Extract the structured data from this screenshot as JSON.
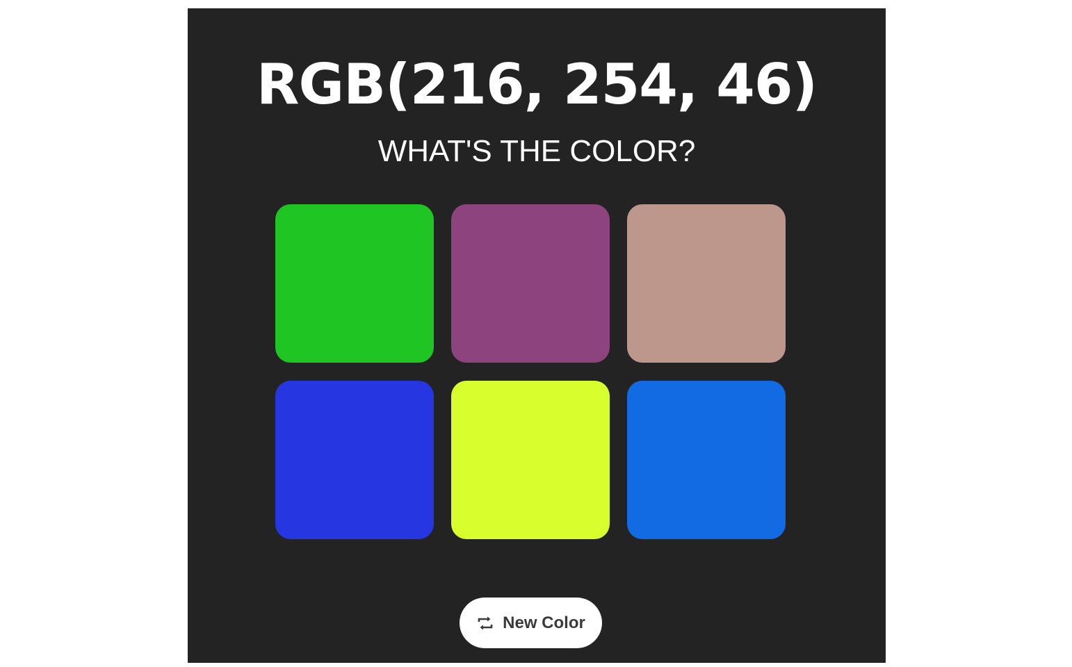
{
  "header": {
    "rgb_label": "RGB(216, 254, 46)",
    "subtitle": "WHAT'S THE COLOR?"
  },
  "swatches": [
    {
      "color": "#1fc623"
    },
    {
      "color": "#8c437e"
    },
    {
      "color": "#bd968c"
    },
    {
      "color": "#2637e2"
    },
    {
      "color": "#d8fe2e"
    },
    {
      "color": "#126be2"
    }
  ],
  "controls": {
    "new_color_label": "New Color",
    "new_color_icon": "repeat-icon"
  },
  "theme": {
    "background": "#232323",
    "text": "#ffffff",
    "button_bg": "#ffffff",
    "button_text": "#3a3a3a"
  }
}
